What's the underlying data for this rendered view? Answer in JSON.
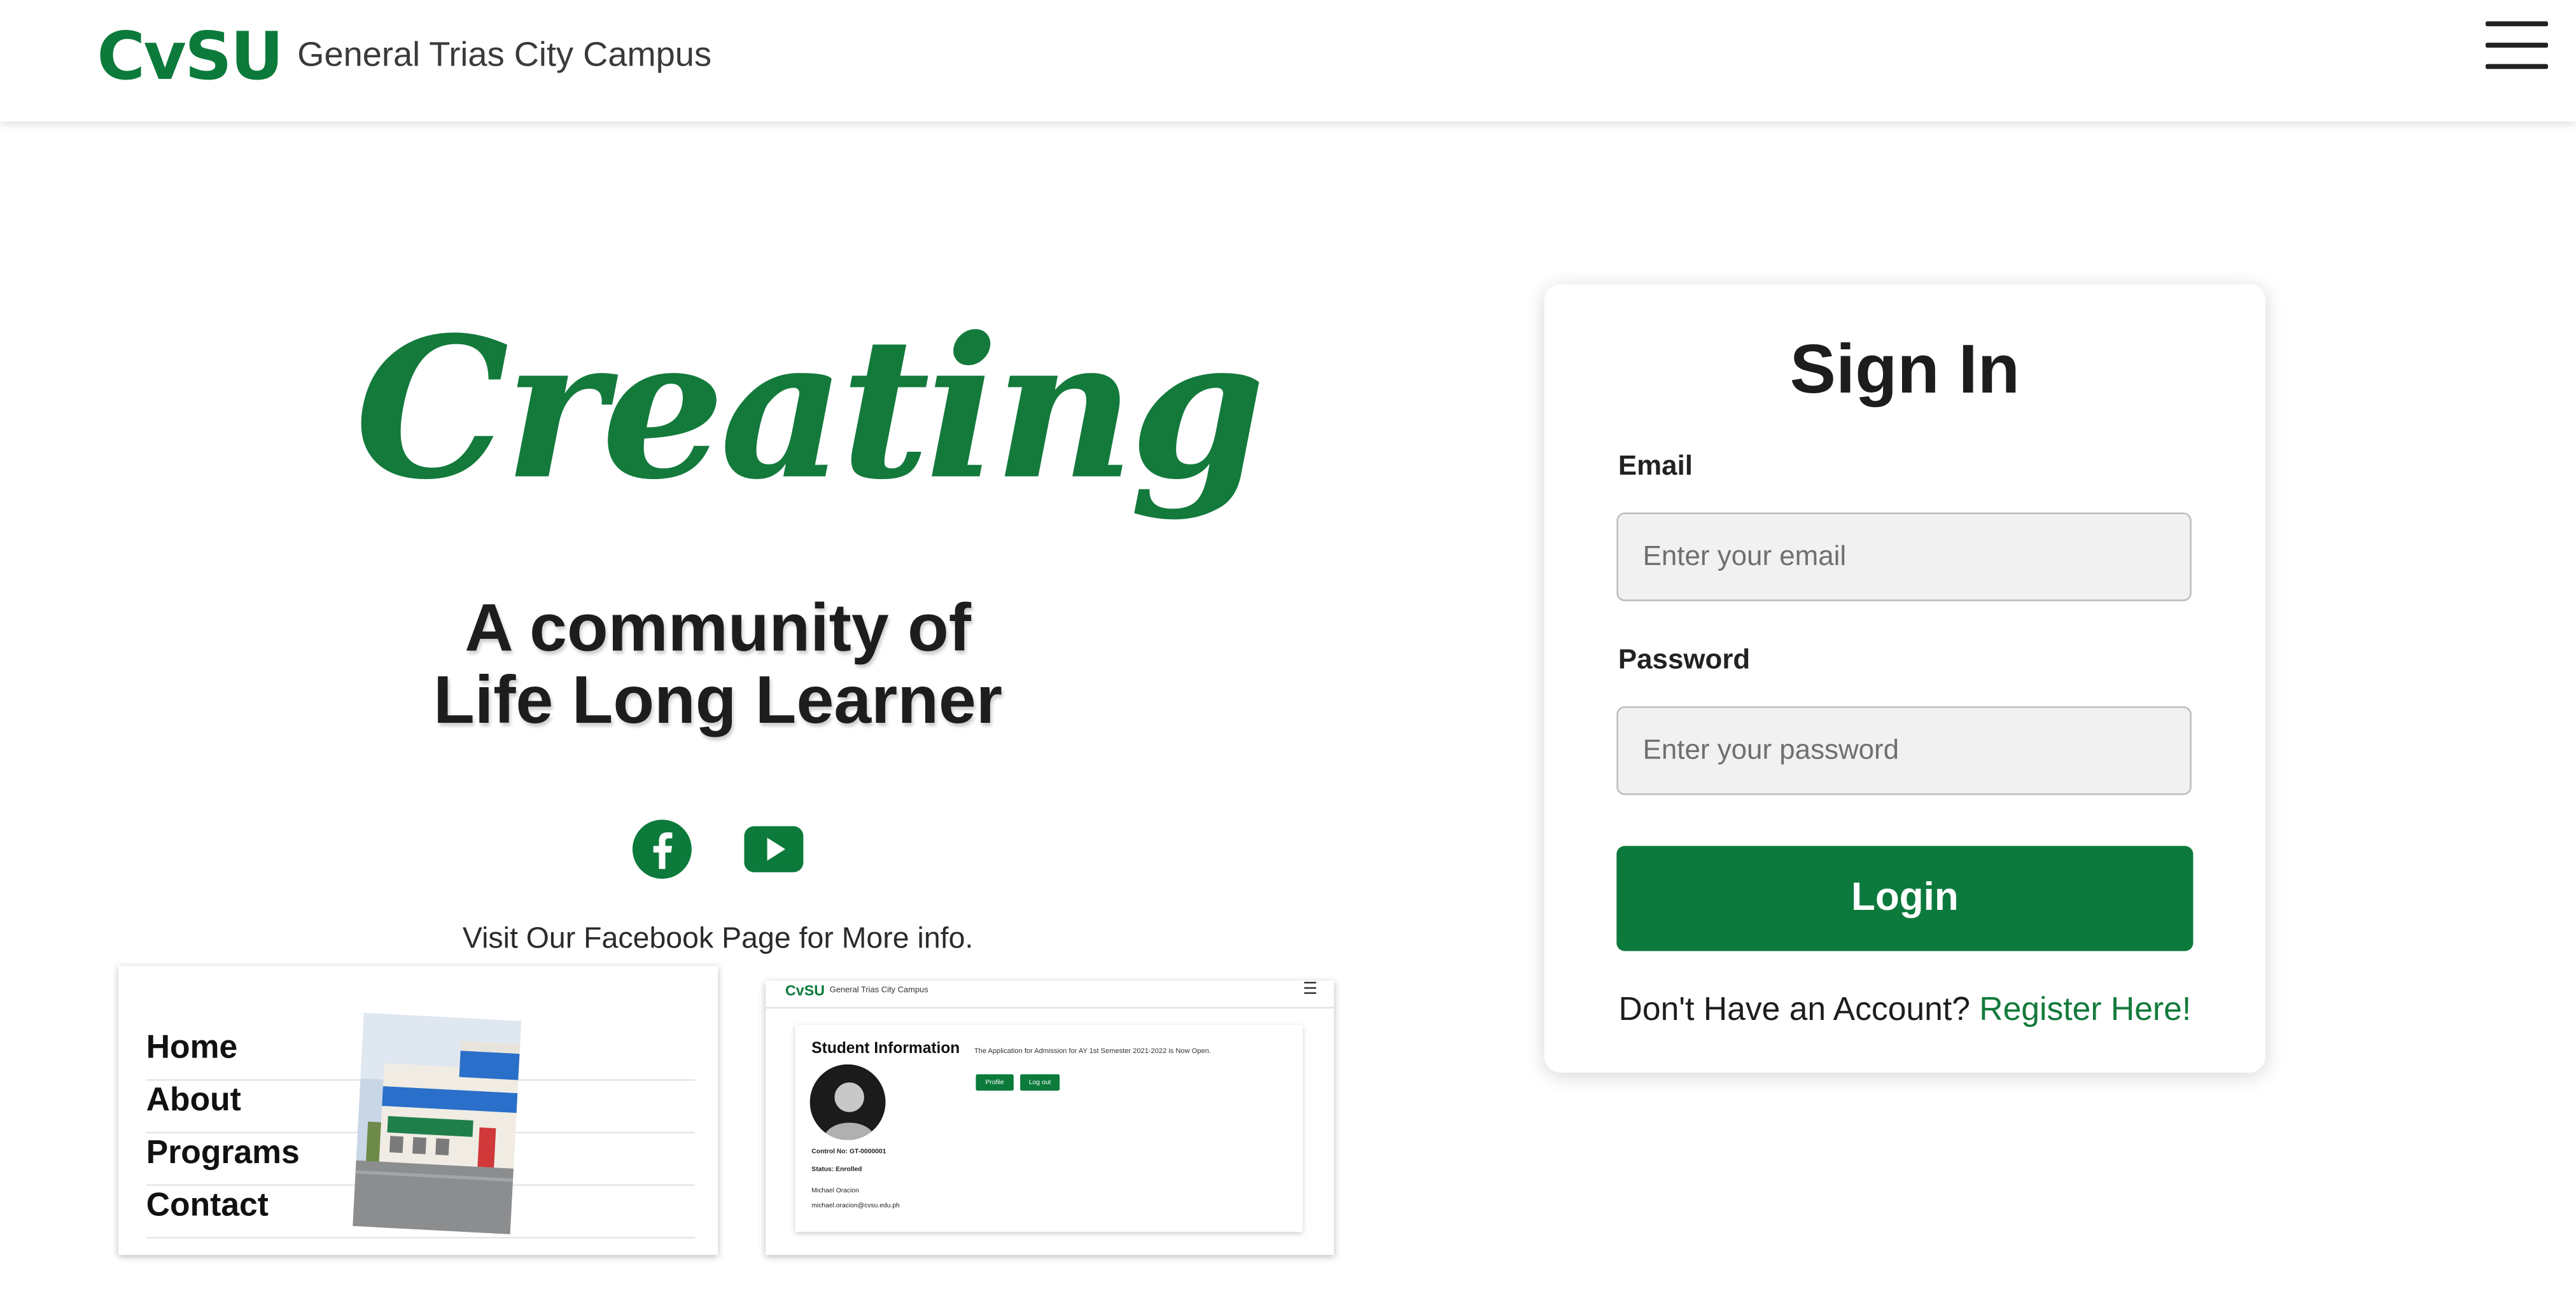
{
  "header": {
    "brand": "CvSU",
    "campus": "General Trias City Campus"
  },
  "hero": {
    "title": "Creating",
    "tagline_line1": "A community of",
    "tagline_line2": "Life Long Learner",
    "visit_text": "Visit Our Facebook Page for More info."
  },
  "socials": {
    "facebook_icon": "facebook-icon",
    "youtube_icon": "youtube-icon"
  },
  "preview_menu": {
    "items": [
      "Home",
      "About",
      "Programs",
      "Contact"
    ]
  },
  "preview_dashboard": {
    "brand": "CvSU",
    "campus": "General Trias City Campus",
    "title": "Student Information",
    "notice": "The Application for Admission for AY 1st Semester 2021-2022 is Now Open.",
    "profile_button": "Profile",
    "logout_button": "Log out",
    "control_no": "Control No: GT-0000001",
    "status": "Status: Enrolled",
    "name": "Michael Oracion",
    "email": "michael.oracion@cvsu.edu.ph"
  },
  "login": {
    "title": "Sign In",
    "email_label": "Email",
    "email_placeholder": "Enter your email",
    "password_label": "Password",
    "password_placeholder": "Enter your password",
    "login_button": "Login",
    "register_prompt": "Don't Have an Account?",
    "register_link": "Register Here!"
  },
  "colors": {
    "brand_green": "#0b7a3b",
    "button_green": "#0d7a3d",
    "text_dark": "#1d1d1d"
  }
}
